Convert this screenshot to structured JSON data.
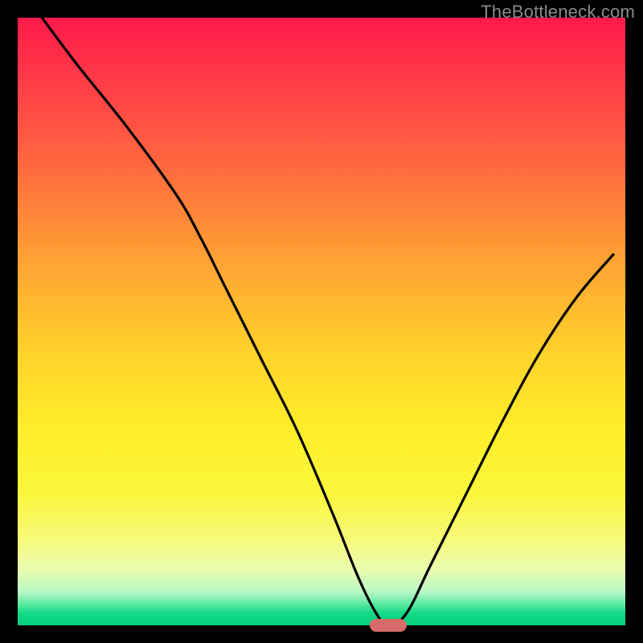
{
  "watermark": {
    "text": "TheBottleneck.com"
  },
  "chart_data": {
    "type": "line",
    "title": "",
    "xlabel": "",
    "ylabel": "",
    "xlim": [
      0,
      100
    ],
    "ylim": [
      0,
      100
    ],
    "grid": false,
    "legend": false,
    "background": "gradient-red-yellow-green",
    "series": [
      {
        "name": "bottleneck-curve",
        "x": [
          4,
          10,
          18,
          26,
          30,
          34,
          40,
          46,
          52,
          56,
          59,
          61,
          64,
          68,
          74,
          80,
          86,
          92,
          98
        ],
        "values": [
          100,
          92,
          82,
          71,
          64,
          56,
          44,
          32,
          18,
          8,
          2,
          0,
          2,
          10,
          22,
          34,
          45,
          54,
          61
        ]
      }
    ],
    "marker": {
      "shape": "pill",
      "color": "#d96a6a",
      "x_center": 61,
      "width_pct": 6,
      "y": 0,
      "height_pct": 2
    }
  }
}
